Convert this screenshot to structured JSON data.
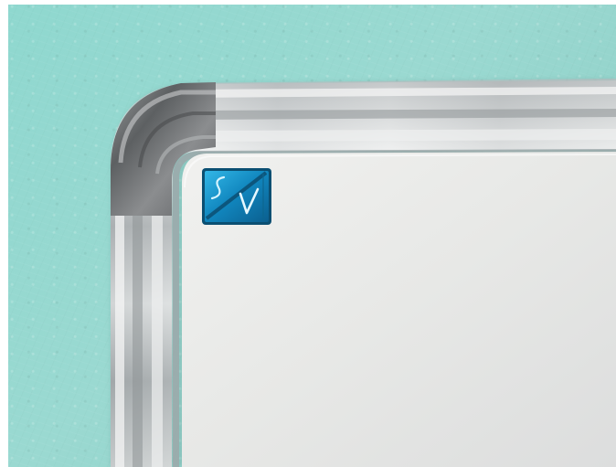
{
  "scene": {
    "subject": "whiteboard-frame-corner",
    "colors": {
      "wall": "#91d6cd",
      "board": "#e8e9e7",
      "frame": "#c9cccc",
      "corner": "#6f7173",
      "logo": "#1787b4"
    }
  },
  "logo": {
    "icon": "brand-logo-icon"
  }
}
